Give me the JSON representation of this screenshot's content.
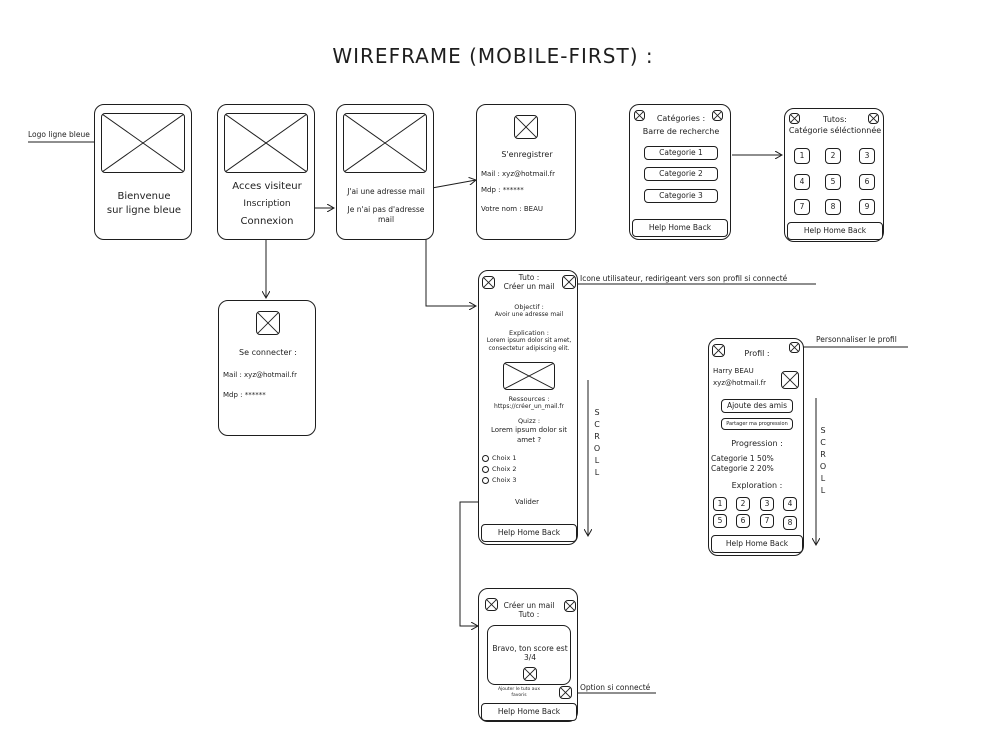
{
  "title": "WIREFRAME (MOBILE-FIRST) :",
  "annotations": {
    "logo": "Logo ligne bleue",
    "user_icon": "Icone utilisateur, redirigeant vers son profil si connecté",
    "personalize": "Personnaliser le profil",
    "option": "Option si connecté"
  },
  "welcome": {
    "line1": "Bienvenue",
    "line2": "sur ligne bleue"
  },
  "visitor": {
    "line1": "Acces visiteur",
    "line2": "Inscription",
    "line3": "Connexion"
  },
  "email_choice": {
    "has_email": "J'ai une adresse mail",
    "no_email": "Je n'ai pas d'adresse mail"
  },
  "register": {
    "title": "S'enregistrer",
    "mail": "Mail : xyz@hotmail.fr",
    "mdp": "Mdp : ******",
    "name": "Votre nom : BEAU"
  },
  "categories": {
    "header": "Catégories :",
    "search": "Barre de recherche",
    "items": [
      "Categorie 1",
      "Categorie 2",
      "Categorie 3"
    ],
    "nav": "Help Home Back"
  },
  "tutos": {
    "header": "Tutos:",
    "subheader": "Catégorie séléctionnée",
    "numbers": [
      "1",
      "2",
      "3",
      "4",
      "5",
      "6",
      "7",
      "8",
      "9"
    ],
    "nav": "Help Home Back"
  },
  "login": {
    "title": "Se connecter :",
    "mail": "Mail : xyz@hotmail.fr",
    "mdp": "Mdp : ******"
  },
  "tuto": {
    "header1": "Tuto :",
    "header2": "Créer un mail",
    "objective_label": "Objectif :",
    "objective_text": "Avoir une adresse mail",
    "explanation_label": "Explication :",
    "explanation_line1": "Lorem ipsum dolor sit amet,",
    "explanation_line2": "consectetur adipiscing elit.",
    "resources_label": "Ressources :",
    "resources_url": "https://créer_un_mail.fr",
    "quiz_label": "Quizz :",
    "quiz_line1": "Lorem ipsum dolor sit",
    "quiz_line2": "amet ?",
    "choices": [
      "Choix 1",
      "Choix 2",
      "Choix 3"
    ],
    "validate": "Valider",
    "nav": "Help Home Back",
    "scroll": [
      "S",
      "C",
      "R",
      "O",
      "L",
      "L"
    ]
  },
  "profile": {
    "header": "Profil :",
    "name": "Harry BEAU",
    "email": "xyz@hotmail.fr",
    "friends_btn": "Ajoute des amis",
    "share_btn": "Partager ma progression",
    "progression_label": "Progression :",
    "progress_rows": [
      "Categorie 1 50%",
      "Categorie 2  20%"
    ],
    "exploration_label": "Exploration :",
    "numbers": [
      "1",
      "2",
      "3",
      "4",
      "5",
      "6",
      "7",
      "8"
    ],
    "nav": "Help Home Back",
    "scroll": [
      "S",
      "C",
      "R",
      "O",
      "L",
      "L"
    ]
  },
  "result": {
    "header1": "Créer un mail",
    "header2": "Tuto :",
    "score_line1": "Bravo, ton score est",
    "score_line2": "3/4",
    "favorite_line1": "Ajouter le tuto aux",
    "favorite_line2": "favoris",
    "nav": "Help Home Back"
  }
}
